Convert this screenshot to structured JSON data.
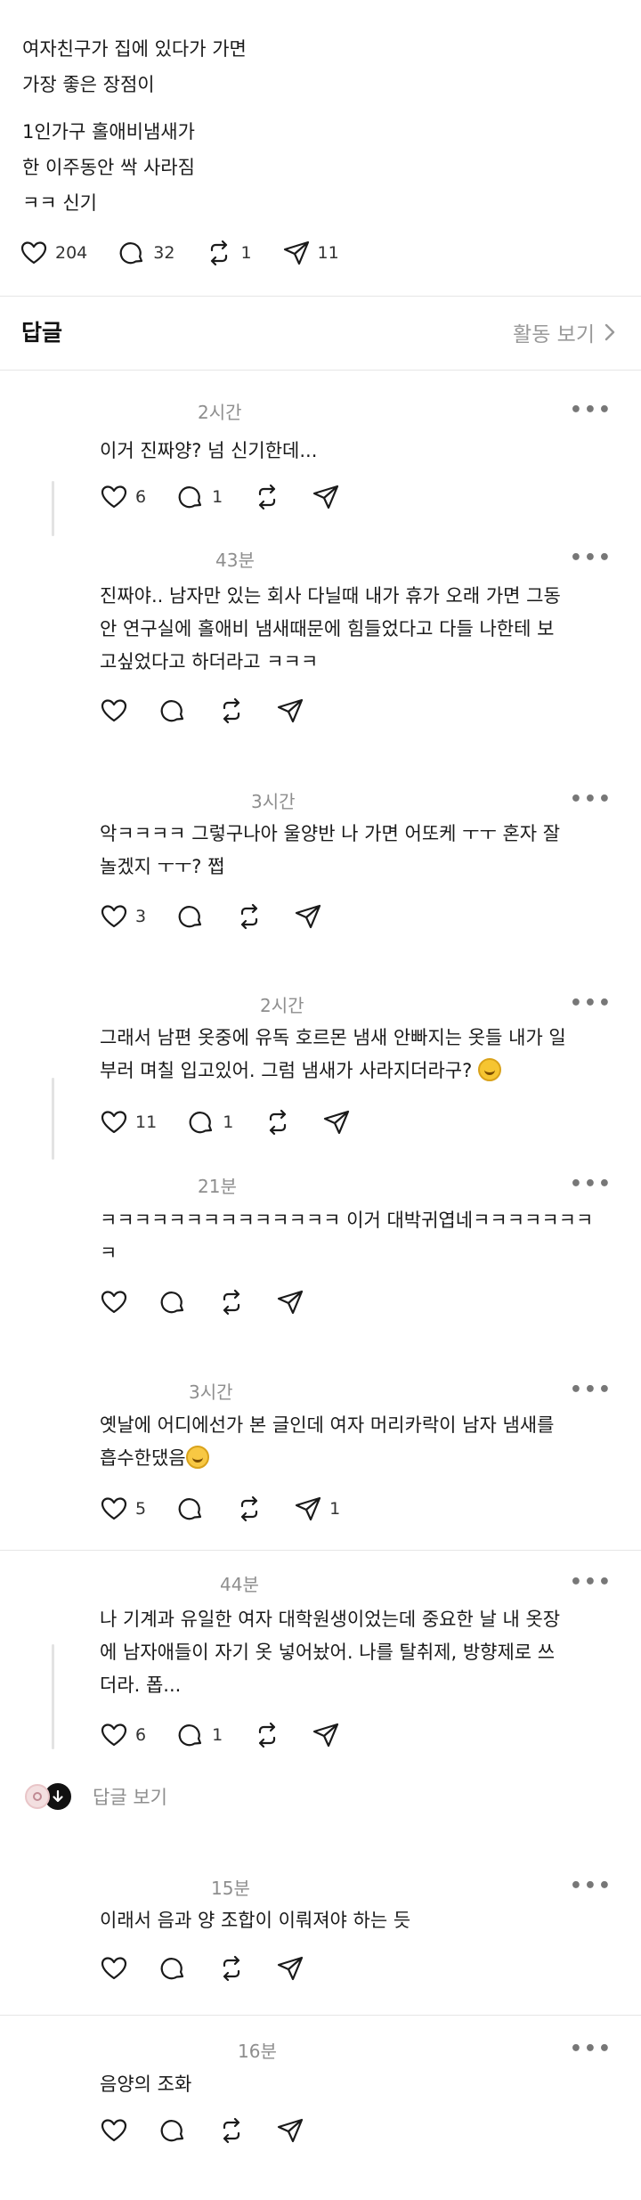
{
  "post": {
    "lines": [
      "여자친구가 집에 있다가 가면",
      "가장 좋은 장점이",
      "1인가구 홀애비냄새가",
      "한 이주동안 싹 사라짐",
      "ㅋㅋ 신기"
    ],
    "likes": "204",
    "comments": "32",
    "reposts": "1",
    "shares": "11"
  },
  "replies_header": {
    "title": "답글",
    "activity_link": "활동 보기",
    "chevron": "chevron-right-icon"
  },
  "comments": [
    {
      "time": "2시간",
      "more": "•••",
      "lines": [
        "이거 진짜양? 넘 신기한데..."
      ],
      "likes": "6",
      "replies": "1"
    },
    {
      "time": "43분",
      "more": "•••",
      "lines": [
        "진짜야.. 남자만 있는 회사 다닐때 내가 휴가 오래 가면 그동",
        "안 연구실에 홀애비 냄새때문에 힘들었다고 다들 나한테 보",
        "고싶었다고 하더라고 ㅋㅋㅋ"
      ]
    },
    {
      "time": "3시간",
      "more": "•••",
      "lines": [
        "악ㅋㅋㅋㅋ 그렇구나아 울양반 나 가면 어또케 ㅜㅜ 혼자 잘",
        "놀겠지 ㅜㅜ? 쩝"
      ],
      "likes": "3"
    },
    {
      "time": "2시간",
      "more": "•••",
      "lines": [
        "그래서 남편 옷중에 유독 호르몬 냄새 안빠지는 옷들 내가 일",
        "부러 며칠 입고있어. 그럼 냄새가 사라지더라구?"
      ],
      "likes": "11",
      "replies": "1",
      "emoji": "grinning-face-emoji"
    },
    {
      "time": "21분",
      "more": "•••",
      "lines": [
        "ㅋㅋㅋㅋㅋㅋㅋㅋㅋㅋㅋㅋㅋㅋ 이거 대박귀엽네ㅋㅋㅋㅋㅋㅋㅋ",
        "ㅋ"
      ]
    },
    {
      "time": "3시간",
      "more": "•••",
      "lines": [
        "옛날에 어디에선가 본 글인데 여자 머리카락이 남자 냄새를",
        "흡수한댔음"
      ],
      "likes": "5",
      "shares": "1",
      "emoji": "laughing-tears-emoji"
    },
    {
      "time": "44분",
      "more": "•••",
      "lines": [
        "나 기계과 유일한 여자 대학원생이었는데 중요한 날 내 옷장",
        "에 남자애들이 자기 옷 넣어놨어. 나를 탈취제, 방향제로 쓰",
        "더라. 폽..."
      ],
      "likes": "6",
      "replies": "1"
    },
    {
      "time": "15분",
      "more": "•••",
      "lines": [
        "이래서 음과 양 조합이 이뤄져야 하는 듯"
      ]
    },
    {
      "time": "16분",
      "more": "•••",
      "lines": [
        "음양의 조화"
      ]
    }
  ],
  "view_replies": "답글 보기"
}
